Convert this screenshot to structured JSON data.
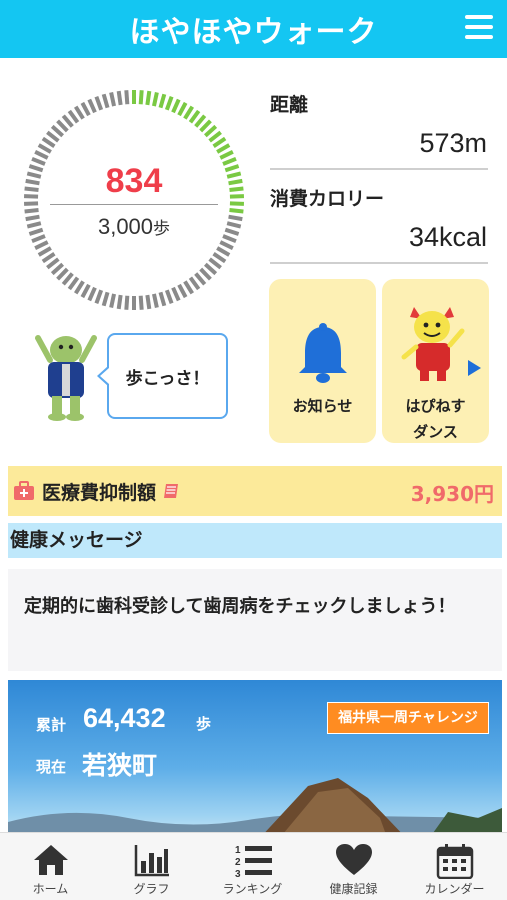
{
  "header": {
    "title": "ほやほやウォーク",
    "menu_icon": "hamburger-menu-icon"
  },
  "steps": {
    "count": "834",
    "goal": "3,000",
    "unit": "歩",
    "progress": 0.278
  },
  "stats": {
    "distance_label": "距離",
    "distance_value": "573m",
    "calories_label": "消費カロリー",
    "calories_value": "34kcal"
  },
  "mascot": {
    "speech": "歩こっさ！"
  },
  "tiles": {
    "notice_label": "お知らせ",
    "dance_label_line1": "はぴねす",
    "dance_label_line2": "ダンス"
  },
  "medical": {
    "label": "医療費抑制額",
    "amount": "3,930円"
  },
  "health": {
    "heading": "健康メッセージ",
    "message": "定期的に歯科受診して歯周病をチェックしましょう！"
  },
  "banner": {
    "cumulative_label": "累計",
    "cumulative_steps": "64,432",
    "cumulative_unit": "歩",
    "current_label": "現在",
    "current_town": "若狭町",
    "challenge_label": "福井県一周チャレンジ"
  },
  "nav": [
    {
      "label": "ホーム",
      "icon": "home-icon"
    },
    {
      "label": "グラフ",
      "icon": "graph-icon"
    },
    {
      "label": "ランキング",
      "icon": "ranking-icon"
    },
    {
      "label": "健康記録",
      "icon": "heart-icon"
    },
    {
      "label": "カレンダー",
      "icon": "calendar-icon"
    }
  ],
  "colors": {
    "header": "#14c6f2",
    "step_count": "#ef3e4a",
    "progress": "#7ac943",
    "track": "#8a8a8a",
    "amount": "#f06a6a",
    "challenge": "#ff8c21"
  }
}
